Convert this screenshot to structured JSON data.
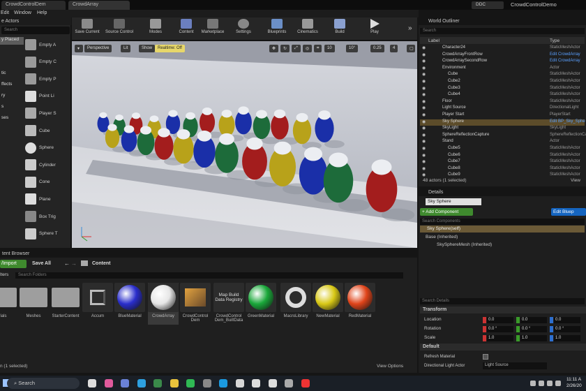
{
  "window": {
    "tabs": [
      "CrowdControlDem",
      "CrowdArray"
    ],
    "project_badge": "DDC",
    "project_name": "CrowdControlDemo"
  },
  "menu": [
    "Edit",
    "Window",
    "Help"
  ],
  "place_actors": {
    "title": "e Actors",
    "search_placeholder": "Search",
    "categories": [
      "y Placed",
      "tic",
      "ffects",
      "ry",
      "s",
      "ses"
    ],
    "items": [
      "Empty A",
      "Empty C",
      "Empty P",
      "Point Li",
      "Player S",
      "Cube",
      "Sphere",
      "Cylinder",
      "Cone",
      "Plane",
      "Box Trig",
      "Sphere T"
    ]
  },
  "toolbar": {
    "buttons": [
      "Save Current",
      "Source Control",
      "Modes",
      "Content",
      "Marketplace",
      "Settings",
      "Blueprints",
      "Cinematics",
      "Build",
      "Play"
    ]
  },
  "viewport": {
    "perspective": "Perspective",
    "lit": "Lit",
    "show": "Show",
    "realtime": "Realtime: Off",
    "grid": "10",
    "angle": "10°",
    "scale": "0.25",
    "cam": "4"
  },
  "content_browser": {
    "title": "tent Browser",
    "import_label": "/Import",
    "save_all": "Save All",
    "path": "Content",
    "filters": "lters",
    "search_placeholder": "Search Folders",
    "status": "n (1 selected)",
    "view_options": "View Options",
    "assets": [
      "rials",
      "Meshes",
      "StarterContent",
      "Accum",
      "BlueMaterial",
      "CrowdArray",
      "CrowdControl Dem",
      "CrowdControl Dem_BuiltData",
      "GreenMaterial",
      "MacroLibrary",
      "NewMaterial",
      "RedMaterial"
    ],
    "built_data_thumb": "Map Build Data Registry"
  },
  "outliner": {
    "title": "World Outliner",
    "search_placeholder": "Search",
    "col_label": "Label",
    "col_type": "Type",
    "count": "48 actors (1 selected)",
    "view": "View",
    "rows": [
      {
        "label": "Character24",
        "type": "StaticMeshActor"
      },
      {
        "label": "CrowdArrayFrontRow",
        "type": "Edit CrowdArray"
      },
      {
        "label": "CrowdArraySecondRow",
        "type": "Edit CrowdArray"
      },
      {
        "label": "Environment",
        "type": "Actor"
      },
      {
        "label": "Cube",
        "type": "StaticMeshActor"
      },
      {
        "label": "Cube2",
        "type": "StaticMeshActor"
      },
      {
        "label": "Cube3",
        "type": "StaticMeshActor"
      },
      {
        "label": "Cube4",
        "type": "StaticMeshActor"
      },
      {
        "label": "Floor",
        "type": "StaticMeshActor"
      },
      {
        "label": "Light Source",
        "type": "DirectionalLight"
      },
      {
        "label": "Player Start",
        "type": "PlayerStart"
      },
      {
        "label": "Sky Sphere",
        "type": "Edit BP_Sky_Sphe"
      },
      {
        "label": "SkyLight",
        "type": "SkyLight"
      },
      {
        "label": "SphereReflectionCapture",
        "type": "SphereReflectionCa"
      },
      {
        "label": "Stand",
        "type": "Actor"
      },
      {
        "label": "Cube5",
        "type": "StaticMeshActor"
      },
      {
        "label": "Cube6",
        "type": "StaticMeshActor"
      },
      {
        "label": "Cube7",
        "type": "StaticMeshActor"
      },
      {
        "label": "Cube8",
        "type": "StaticMeshActor"
      },
      {
        "label": "Cube9",
        "type": "StaticMeshActor"
      }
    ]
  },
  "details": {
    "title": "Details",
    "name_value": "Sky Sphere",
    "add_component": "+ Add Component",
    "edit_blueprint": "Edit Bluep",
    "search_components": "Search Components",
    "self": "Sky Sphere(self)",
    "base": "Base (Inherited)",
    "mesh": "SkySphereMesh (Inherited)",
    "search_details": "Search Details",
    "transform": "Transform",
    "location": "Location",
    "rotation": "Rotation",
    "scale": "Scale",
    "default": "Default",
    "refresh": "Refresh Material",
    "dir_light": "Directional Light Actor",
    "dir_light_value": "Light Source",
    "loc": [
      "0.0",
      "0.0",
      "0.0"
    ],
    "rot": [
      "0.0 °",
      "0.0 °",
      "0.0 °"
    ],
    "scl": [
      "1.0",
      "1.0",
      "1.0"
    ]
  },
  "taskbar": {
    "search": "Search",
    "time": "11:11 A",
    "date": "2/26/20"
  },
  "colors": {
    "accent": "#e2a233",
    "selected": "#5c4c2a",
    "green": "#2e8b2e",
    "blue": "#1565c0"
  }
}
